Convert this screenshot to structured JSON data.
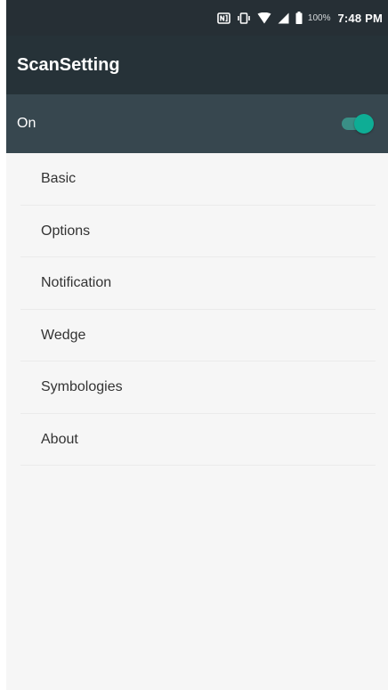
{
  "status_bar": {
    "icons": [
      "nfc-icon",
      "vibrate-icon",
      "wifi-icon",
      "cell-signal-icon",
      "battery-icon"
    ],
    "battery": "100%",
    "time": "7:48 PM"
  },
  "toolbar": {
    "title": "ScanSetting"
  },
  "master_switch": {
    "label": "On",
    "enabled": true
  },
  "menu": {
    "items": [
      {
        "label": "Basic"
      },
      {
        "label": "Options"
      },
      {
        "label": "Notification"
      },
      {
        "label": "Wedge"
      },
      {
        "label": "Symbologies"
      },
      {
        "label": "About"
      }
    ]
  },
  "colors": {
    "status_bar": "#262f35",
    "toolbar": "#263238",
    "switch_bar": "#37474f",
    "accent": "#0ead95",
    "background": "#f6f6f6"
  }
}
